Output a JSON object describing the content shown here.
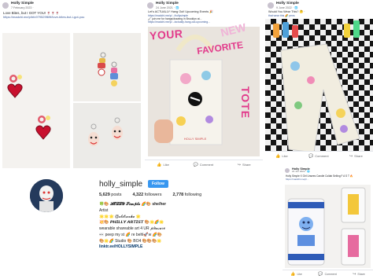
{
  "colors": {
    "facebook_link": "#385898",
    "instagram_follow": "#3897f0",
    "checkerboard_dark": "#151515",
    "heart_red": "#c8102e"
  },
  "post1": {
    "author": "Holly Simple",
    "date": "7 February 2023 · ",
    "caption": "Love Bites, but I GOT YOU! 🍷🍷🍷",
    "link": "https://madchi.me/p/bfc979529f69f/love-bites-but-i-got-you"
  },
  "post2": {
    "author": "Holly Simple",
    "date": "24 June 2021 · 🌐",
    "caption_line1": "Let's ACTUALLY Hang Out! Upcoming Events 🎉",
    "link1": "https://madchi.me/p/.../hollysimple",
    "caption_line2": "🖌 join me for hangs/drawing in Brooklyn at...",
    "link2": "https://madchi.me/p/.../actually-hang-out-upcoming...",
    "caption_line3": "🖌 hosting a workshop w/ BOK and you should come!",
    "tote_text": [
      "YOUR",
      "NEW",
      "FAVORITE",
      "TOTE"
    ],
    "tote_signature": "HOLLY SIMPLE",
    "actions": {
      "like": "Like",
      "comment": "Comment",
      "share": "Share"
    }
  },
  "post3": {
    "author": "Holly Simple",
    "date": "9 June 2022 · 🌐",
    "caption": "Would You Wear This? 🤔 ·",
    "link": "https://madchi.me/p/...wear-this",
    "link2": "that wear this 🌈 pens",
    "actions": {
      "like": "Like",
      "comment": "Comment",
      "share": "Share"
    }
  },
  "profile": {
    "username": "holly_simple",
    "follow_label": "Follow",
    "posts_count": "5,629",
    "posts_label": "posts",
    "followers_count": "4,322",
    "followers_label": "followers",
    "following_count": "2,778",
    "following_label": "following",
    "bio": [
      "🍀🎨 𝓗𝓞𝓛𝓛𝓨 𝓢𝓲𝓶𝓹𝓵𝓮 🌈🎨 she/her",
      "Artist",
      "🌟🌟🌟 @𝓬𝓵𝓲𝓽𝓻𝓸𝓬𝓱𝓮 🌟",
      "💥🎨 𝙋𝙃𝙄𝙇𝙇𝙔 𝘼𝙍𝙏𝙄𝙎𝙏 🎨🌟🌈🌟",
      "wearable shareable art 4 UR 𝓅𝓁𝑒𝒶𝓈𝓊𝓇𝑒",
      "👀 peep my st 🌈 re behl🚀w 🌈🎨",
      "🎨🌟🌈 Studio 🎨 BO4 🎨🎨🎨🌟",
      "linktr.ee/HOLLYSIMPLE"
    ]
  },
  "post5": {
    "author": "Holly Simple",
    "date": "22 Jun 2022 · 🌐",
    "caption": "Holly Simple X Girl Unsees Candle Collab Selling F A S T 🔥",
    "link": "https://madchi.me/p/...",
    "actions": {
      "like": "Like",
      "comment": "Comment",
      "share": "Share"
    }
  }
}
